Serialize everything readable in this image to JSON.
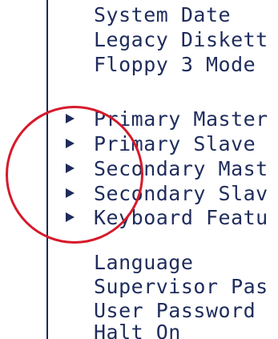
{
  "menu": {
    "items": [
      {
        "label": "System Date",
        "submenu": false
      },
      {
        "label": "Legacy Diskett",
        "submenu": false
      },
      {
        "label": "Floppy 3 Mode",
        "submenu": false
      },
      {
        "label": "Primary Master",
        "submenu": true
      },
      {
        "label": "Primary Slave",
        "submenu": true
      },
      {
        "label": "Secondary Mast",
        "submenu": true
      },
      {
        "label": "Secondary Slav",
        "submenu": true
      },
      {
        "label": "Keyboard Featu",
        "submenu": true
      },
      {
        "label": "Language",
        "submenu": false
      },
      {
        "label": "Supervisor Pas",
        "submenu": false
      },
      {
        "label": "User Password",
        "submenu": false
      },
      {
        "label": "Halt On",
        "submenu": false
      }
    ]
  },
  "submenu_arrow_icon": "triangle-right",
  "colors": {
    "text": "#1f2c5c",
    "background": "#ffffff",
    "highlight_circle": "#d61a2b"
  }
}
